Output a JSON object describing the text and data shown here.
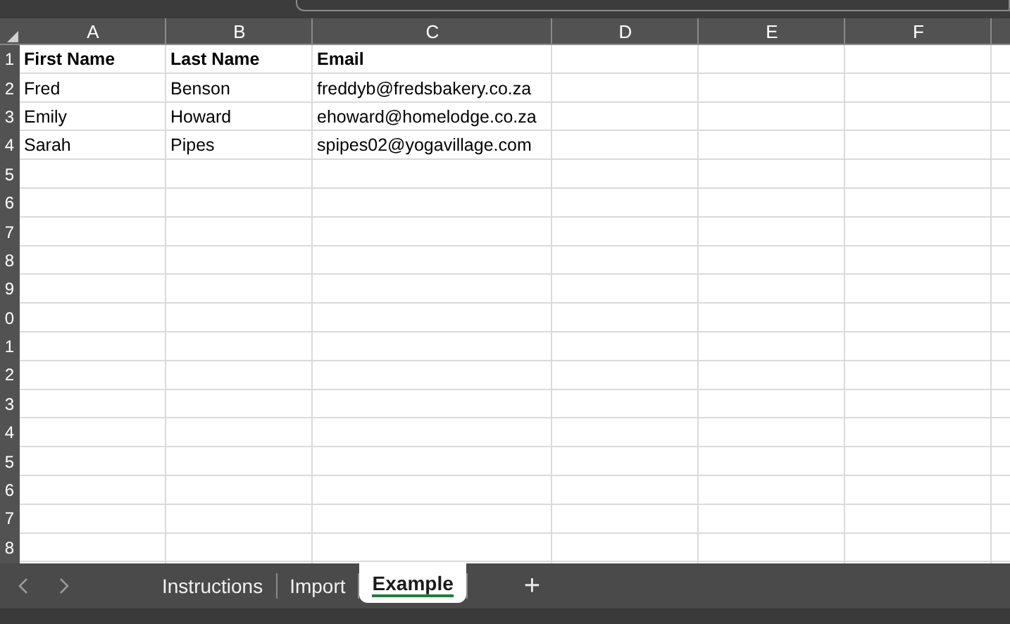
{
  "columns": [
    "A",
    "B",
    "C",
    "D",
    "E",
    "F"
  ],
  "row_headers": [
    "1",
    "2",
    "3",
    "4",
    "5",
    "6",
    "7",
    "8",
    "9",
    "0",
    "1",
    "2",
    "3",
    "4",
    "5",
    "6",
    "7",
    "8"
  ],
  "rows": [
    {
      "cells": [
        "First Name",
        "Last Name",
        "Email"
      ],
      "header": true
    },
    {
      "cells": [
        "Fred",
        "Benson",
        "freddyb@fredsbakery.co.za"
      ],
      "header": false
    },
    {
      "cells": [
        "Emily",
        "Howard",
        "ehoward@homelodge.co.za"
      ],
      "header": false
    },
    {
      "cells": [
        "Sarah",
        "Pipes",
        "spipes02@yogavillage.com"
      ],
      "header": false
    }
  ],
  "sheet_tabs": [
    {
      "label": "Instructions",
      "selected": false
    },
    {
      "label": "Import",
      "selected": false
    },
    {
      "label": "Example",
      "selected": true
    }
  ],
  "add_sheet": "+"
}
